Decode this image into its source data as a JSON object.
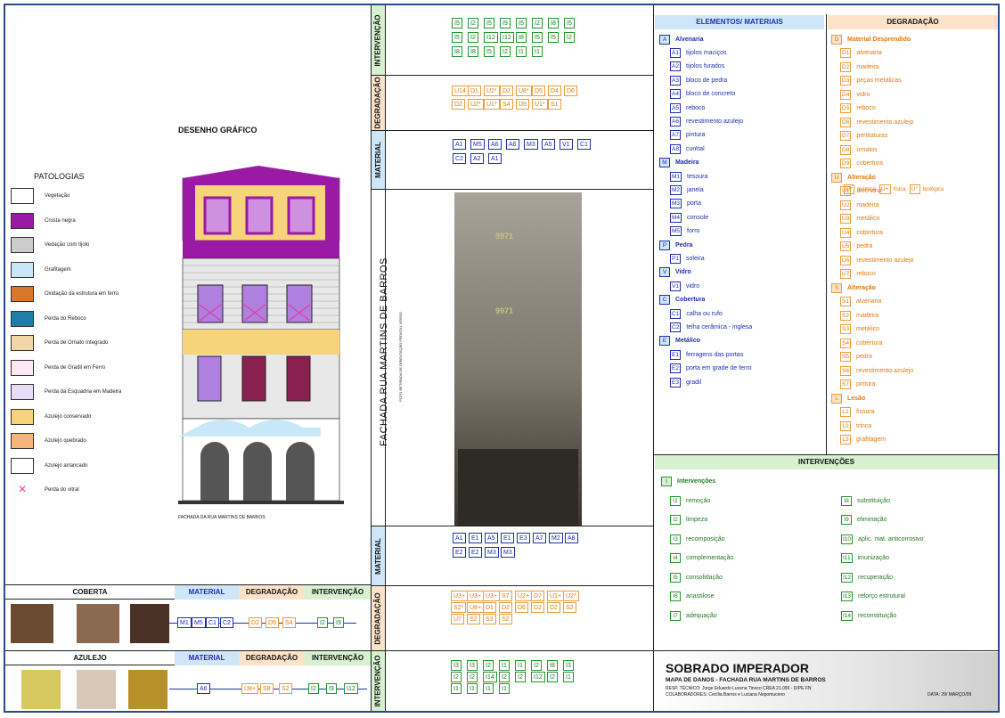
{
  "left": {
    "drawing_title": "DESENHO GRÁFICO",
    "patologias_title": "PATOLOGIAS",
    "caption": "FACHADA DA RUA MARTINS DE BARROS",
    "legend": [
      {
        "label": "Vegetação",
        "color": "#ffffff"
      },
      {
        "label": "Crosta negra",
        "color": "#9a1aa6"
      },
      {
        "label": "Vedação com tijolo",
        "color": "#cccccc"
      },
      {
        "label": "Grafitagem",
        "color": "#c8e8f8"
      },
      {
        "label": "Oxidação da estrutura em ferro",
        "color": "#d9772a"
      },
      {
        "label": "Perda do Reboco",
        "color": "#1d7ea8"
      },
      {
        "label": "Perda de Ornato Integrado",
        "color": "#f3d6a6"
      },
      {
        "label": "Perda de Gradil em Ferro",
        "color": "#ffe8f4"
      },
      {
        "label": "Perda da Esquadria em Madeira",
        "color": "#e8dcf6"
      },
      {
        "label": "Azulejo conservado",
        "color": "#f7d37a"
      },
      {
        "label": "Azulejo quebrado",
        "color": "#f6b67a"
      },
      {
        "label": "Azulejo arrancado",
        "color": "#ffffff"
      },
      {
        "label": "Perda do vitral",
        "color": "#ffffff",
        "x": true
      }
    ]
  },
  "bottom_tables": {
    "coberta": {
      "title": "COBERTA",
      "material": "MATERIAL",
      "degradacao": "DEGRADAÇÃO",
      "intervencao": "INTERVENÇÃO",
      "m": [
        "M1",
        "M5",
        "C1",
        "C2"
      ],
      "d": [
        "D2",
        "D5",
        "S4"
      ],
      "i": [
        "I2",
        "I9"
      ]
    },
    "azulejo": {
      "title": "AZULEJO",
      "material": "MATERIAL",
      "degradacao": "DEGRADAÇÃO",
      "intervencao": "INTERVENÇÃO",
      "m": [
        "A6"
      ],
      "d": [
        "U8+",
        "S8",
        "S2"
      ],
      "i": [
        "I2",
        "I9",
        "I12"
      ]
    }
  },
  "center": {
    "labels": {
      "intervencao": "INTERVENÇÃO",
      "degradacao": "DEGRADAÇÃO",
      "material": "MATERIAL",
      "fachada": "FACHADA RUA MARTINS DE BARROS",
      "foto_note": "FOTO RETIRADA DE ORIENTAÇÃO FRONTAL VERSO"
    },
    "sign1": "9971",
    "sign2": "9971",
    "top_i": [
      "I5",
      "I2",
      "I5",
      "I9",
      "I5",
      "I2",
      "I8",
      "I5",
      "I5",
      "I2",
      "I12",
      "I12",
      "I8",
      "I5",
      "I5",
      "I2",
      "I8",
      "I8",
      "I5",
      "I2",
      "I1",
      "I1"
    ],
    "top_d": [
      "U14",
      "D1",
      "U2*",
      "D2",
      "U8*",
      "D5",
      "D4",
      "D6",
      "D2",
      "U2*",
      "U1*",
      "S4",
      "D9",
      "U1*",
      "S1"
    ],
    "top_m": [
      "A1",
      "M5",
      "A6",
      "A6",
      "M3",
      "A5",
      "V1",
      "C1",
      "C2",
      "A2",
      "A1"
    ],
    "bot_m": [
      "A1",
      "E1",
      "A5",
      "E1",
      "E3",
      "A7",
      "M2",
      "A8",
      "E2",
      "E2",
      "M3",
      "M3"
    ],
    "bot_d": [
      "U3+",
      "U3+",
      "U3+",
      "S7",
      "U2+",
      "D7",
      "U1+",
      "U2*",
      "S2*",
      "U8+",
      "D1",
      "D2",
      "D6",
      "D2",
      "D2",
      "S2",
      "U7",
      "S2",
      "S3",
      "S2"
    ],
    "bot_i": [
      "I3",
      "I3",
      "I2",
      "I1",
      "I1",
      "I2",
      "I8",
      "I3",
      "I2",
      "I2",
      "I14",
      "I2",
      "I2",
      "I12",
      "I2",
      "I1",
      "I1",
      "I1",
      "I1",
      "I1"
    ]
  },
  "elementos": {
    "title": "ELEMENTOS/ MATERIAIS",
    "items": [
      {
        "code": "A",
        "label": "Alvenaria",
        "cat": true
      },
      {
        "code": "A1",
        "label": "tijolos maciços"
      },
      {
        "code": "A2",
        "label": "tijolos furados"
      },
      {
        "code": "A3",
        "label": "bloco de pedra"
      },
      {
        "code": "A4",
        "label": "bloco de concreto"
      },
      {
        "code": "A5",
        "label": "reboco"
      },
      {
        "code": "A6",
        "label": "revestimento azulejo"
      },
      {
        "code": "A7",
        "label": "pintura"
      },
      {
        "code": "A8",
        "label": "cunhal"
      },
      {
        "code": "M",
        "label": "Madeira",
        "cat": true
      },
      {
        "code": "M1",
        "label": "tesoura"
      },
      {
        "code": "M2",
        "label": "janela"
      },
      {
        "code": "M3",
        "label": "porta"
      },
      {
        "code": "M4",
        "label": "console"
      },
      {
        "code": "M5",
        "label": "forro"
      },
      {
        "code": "P",
        "label": "Pedra",
        "cat": true
      },
      {
        "code": "P1",
        "label": "soleira"
      },
      {
        "code": "V",
        "label": "Vidro",
        "cat": true
      },
      {
        "code": "V1",
        "label": "vidro"
      },
      {
        "code": "C",
        "label": "Cobertura",
        "cat": true
      },
      {
        "code": "C1",
        "label": "calha ou rufo"
      },
      {
        "code": "C2",
        "label": "telha cerâmica - inglesa"
      },
      {
        "code": "E",
        "label": "Metálico",
        "cat": true
      },
      {
        "code": "E1",
        "label": "ferragens das portas"
      },
      {
        "code": "E2",
        "label": "porta em grade de ferro"
      },
      {
        "code": "E3",
        "label": "gradil"
      }
    ]
  },
  "degradacao": {
    "title": "DEGRADAÇÃO",
    "items": [
      {
        "code": "D",
        "label": "Material Desprendido",
        "cat": true
      },
      {
        "code": "D1",
        "label": "alvenaria"
      },
      {
        "code": "D2",
        "label": "madeira"
      },
      {
        "code": "D3",
        "label": "peças metálicas"
      },
      {
        "code": "D4",
        "label": "vidro"
      },
      {
        "code": "D5",
        "label": "reboco"
      },
      {
        "code": "D6",
        "label": "revestimento azulejo"
      },
      {
        "code": "D7",
        "label": "pertitaturas"
      },
      {
        "code": "D8",
        "label": "ornatos"
      },
      {
        "code": "D9",
        "label": "cobertura"
      },
      {
        "code": "U",
        "label": "Alteração",
        "cat": true
      },
      {
        "code": "U1",
        "label": "alvenaria"
      },
      {
        "code": "U2",
        "label": "madeira"
      },
      {
        "code": "U3",
        "label": "metálico"
      },
      {
        "code": "U4",
        "label": "cobertura"
      },
      {
        "code": "U5",
        "label": "pedra"
      },
      {
        "code": "U6",
        "label": "revestimento azulejo"
      },
      {
        "code": "U7",
        "label": "reboco"
      },
      {
        "code": "S",
        "label": "Alteração",
        "cat": true
      },
      {
        "code": "S1",
        "label": "alvenaria"
      },
      {
        "code": "S2",
        "label": "madeira"
      },
      {
        "code": "S3",
        "label": "metálico"
      },
      {
        "code": "S4",
        "label": "cobertura"
      },
      {
        "code": "S5",
        "label": "pedra"
      },
      {
        "code": "S6",
        "label": "revestimento azulejo"
      },
      {
        "code": "S7",
        "label": "pintura"
      },
      {
        "code": "L",
        "label": "Lesão",
        "cat": true
      },
      {
        "code": "L1",
        "label": "fissura"
      },
      {
        "code": "L2",
        "label": "trinca"
      },
      {
        "code": "L3",
        "label": "grafitagem"
      }
    ],
    "u_sub": {
      "a": "química",
      "b": "física",
      "c": "biológica",
      "ca": "U*",
      "cb": "U+",
      "cc": "U°"
    }
  },
  "intervencoes": {
    "title": "INTERVENÇÕES",
    "head": {
      "code": "I",
      "label": "Intervenções"
    },
    "col1": [
      {
        "code": "I1",
        "label": "remoção"
      },
      {
        "code": "I2",
        "label": "limpeza"
      },
      {
        "code": "I3",
        "label": "recomposição"
      },
      {
        "code": "I4",
        "label": "complementação"
      },
      {
        "code": "I5",
        "label": "consolidação"
      },
      {
        "code": "I6",
        "label": "anastilose"
      },
      {
        "code": "I7",
        "label": "adequação"
      }
    ],
    "col2": [
      {
        "code": "I8",
        "label": "substituição"
      },
      {
        "code": "I9",
        "label": "eliminação"
      },
      {
        "code": "I10",
        "label": "aplic. mat. anticorrosivo"
      },
      {
        "code": "I11",
        "label": "imunização"
      },
      {
        "code": "I12",
        "label": "recuperação"
      },
      {
        "code": "I13",
        "label": "reforço estrutural"
      },
      {
        "code": "I14",
        "label": "reconstituição"
      }
    ]
  },
  "title_block": {
    "title": "SOBRADO IMPERADOR",
    "subtitle": "MAPA DE DANOS - FACHADA RUA MARTINS DE BARROS",
    "resp": "RESP. TÉCNICO: Jorge Eduardo Lucena Tinoco   CREA 21.099 - D/PE FN",
    "colab": "COLABORADORES: Cecília Barros e Luciana Nepomuceno",
    "date": "DATA: 29/ MARÇO/09"
  }
}
